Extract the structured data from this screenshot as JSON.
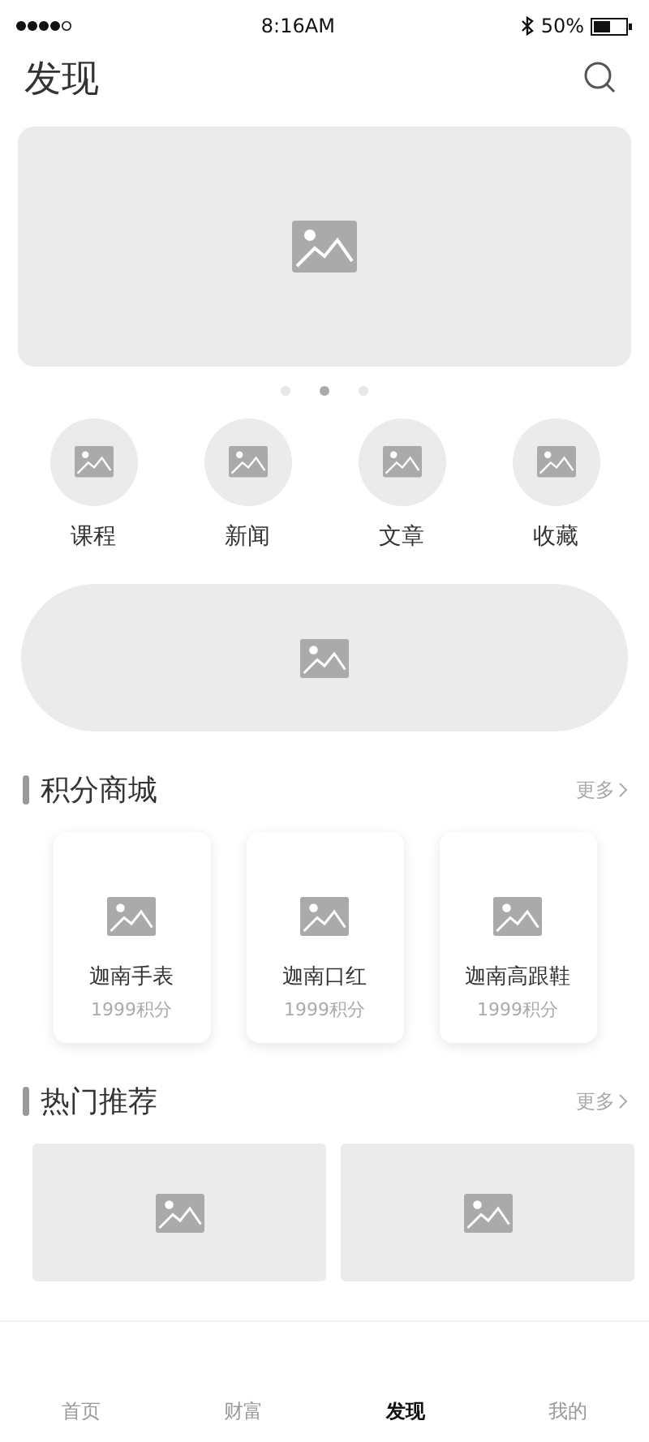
{
  "status_bar": {
    "time": "8:16AM",
    "battery": "50%"
  },
  "header": {
    "title": "发现"
  },
  "carousel": {
    "dots": [
      {
        "selected": false
      },
      {
        "selected": true
      },
      {
        "selected": false
      }
    ]
  },
  "shortcuts": [
    {
      "label": "课程"
    },
    {
      "label": "新闻"
    },
    {
      "label": "文章"
    },
    {
      "label": "收藏"
    }
  ],
  "points_mall": {
    "title": "积分商城",
    "more": "更多",
    "products": [
      {
        "name": "迦南手表",
        "points": "1999积分"
      },
      {
        "name": "迦南口红",
        "points": "1999积分"
      },
      {
        "name": "迦南高跟鞋",
        "points": "1999积分"
      }
    ]
  },
  "hot": {
    "title": "热门推荐",
    "more": "更多"
  },
  "tab_bar": [
    {
      "label": "首页",
      "selected": false
    },
    {
      "label": "财富",
      "selected": false
    },
    {
      "label": "发现",
      "selected": true
    },
    {
      "label": "我的",
      "selected": false
    }
  ]
}
